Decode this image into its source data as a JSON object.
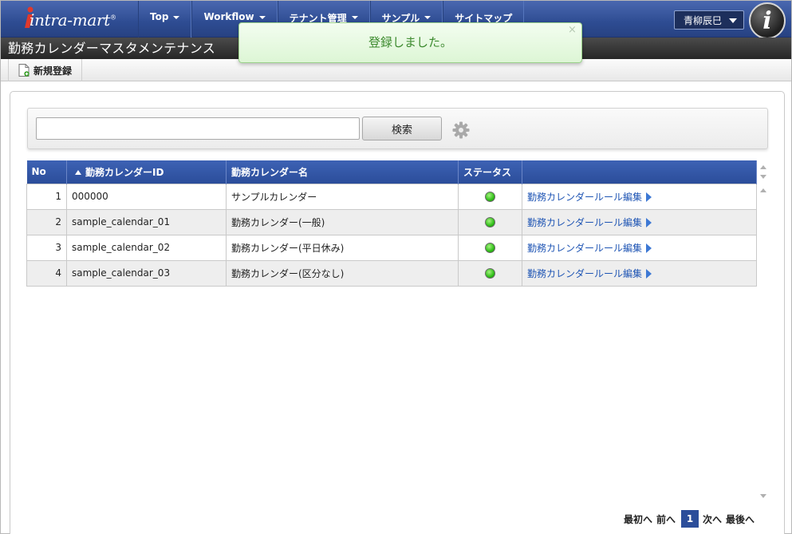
{
  "app": {
    "logo_text": "intra-mart",
    "logo_reg": "®",
    "nav": [
      {
        "label": "Top",
        "dropdown": true
      },
      {
        "label": "Workflow",
        "dropdown": true
      },
      {
        "label": "テナント管理",
        "dropdown": true
      },
      {
        "label": "サンプル",
        "dropdown": true
      },
      {
        "label": "サイトマップ",
        "dropdown": false
      }
    ],
    "user_name": "青柳辰巳",
    "badge_letter": "i"
  },
  "page": {
    "title": "勤務カレンダーマスタメンテナンス"
  },
  "toolbar": {
    "new_label": "新規登録"
  },
  "toast": {
    "message": "登録しました。",
    "close": "×"
  },
  "search": {
    "value": "",
    "placeholder": "",
    "button_label": "検索"
  },
  "table": {
    "headers": {
      "no": "No",
      "id": "勤務カレンダーID",
      "name": "勤務カレンダー名",
      "status": "ステータス",
      "action": ""
    },
    "rows": [
      {
        "no": "1",
        "id": "000000",
        "name": "サンプルカレンダー",
        "action": "勤務カレンダールール編集"
      },
      {
        "no": "2",
        "id": "sample_calendar_01",
        "name": "勤務カレンダー(一般)",
        "action": "勤務カレンダールール編集"
      },
      {
        "no": "3",
        "id": "sample_calendar_02",
        "name": "勤務カレンダー(平日休み)",
        "action": "勤務カレンダールール編集"
      },
      {
        "no": "4",
        "id": "sample_calendar_03",
        "name": "勤務カレンダー(区分なし)",
        "action": "勤務カレンダールール編集"
      }
    ]
  },
  "pager": {
    "first": "最初へ",
    "prev": "前へ",
    "current": "1",
    "next": "次へ",
    "last": "最後へ"
  },
  "colors": {
    "nav_blue": "#2e4c92",
    "header_blue": "#2b4d9a",
    "toast_green": "#3c8a2e",
    "status_green": "#2fbe18",
    "link_blue": "#1f55b4"
  }
}
